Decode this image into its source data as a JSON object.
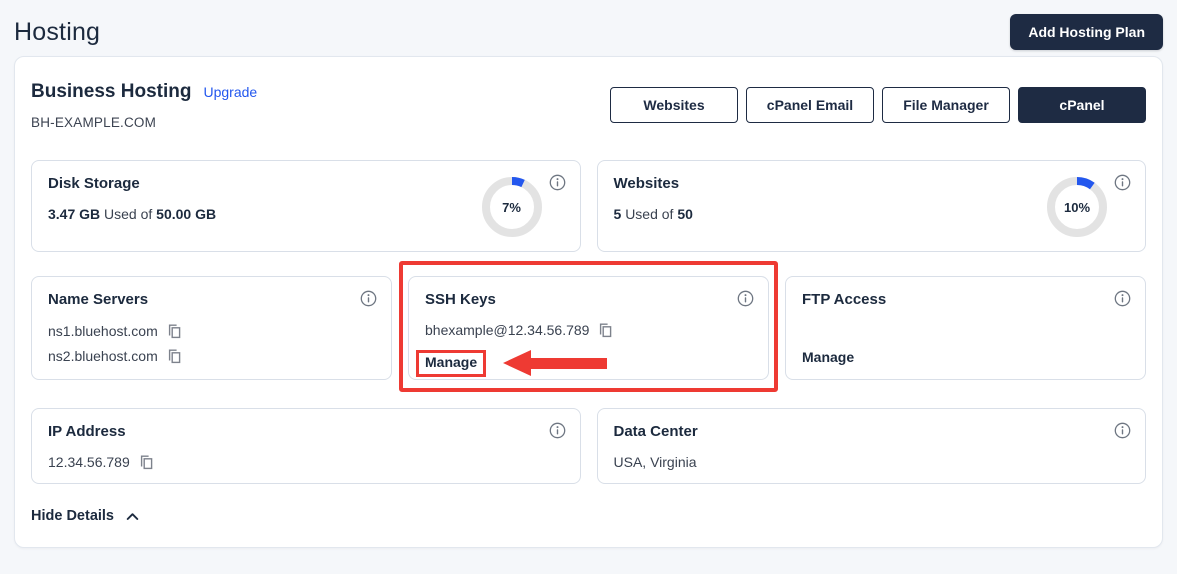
{
  "page": {
    "title": "Hosting"
  },
  "topbar": {
    "add_button": "Add Hosting Plan"
  },
  "plan": {
    "name": "Business Hosting",
    "upgrade_link": "Upgrade",
    "domain": "BH-EXAMPLE.COM",
    "actions": [
      "Websites",
      "cPanel Email",
      "File Manager",
      "cPanel"
    ]
  },
  "cards": {
    "disk_storage": {
      "title": "Disk Storage",
      "used": "3.47 GB",
      "middle": "Used of",
      "total": "50.00 GB",
      "percent": 7,
      "percent_label": "7%"
    },
    "websites": {
      "title": "Websites",
      "used": "5",
      "middle": "Used of",
      "total": "50",
      "percent": 10,
      "percent_label": "10%"
    },
    "name_servers": {
      "title": "Name Servers",
      "values": [
        "ns1.bluehost.com",
        "ns2.bluehost.com"
      ]
    },
    "ssh_keys": {
      "title": "SSH Keys",
      "value": "bhexample@12.34.56.789",
      "manage_link": "Manage"
    },
    "ftp_access": {
      "title": "FTP Access",
      "manage_link": "Manage"
    },
    "ip_address": {
      "title": "IP Address",
      "value": "12.34.56.789"
    },
    "data_center": {
      "title": "Data Center",
      "value": "USA, Virginia"
    }
  },
  "footer": {
    "hide_details": "Hide Details"
  },
  "icons": {
    "info": "info-icon",
    "copy": "copy-icon",
    "chevron_up": "chevron-up-icon"
  },
  "colors": {
    "accent_blue": "#2357ee",
    "navy": "#1e2b43",
    "annotation_red": "#ee3a33",
    "ring_gray": "#e3e3e3",
    "page_background": "#f5f7fa"
  }
}
